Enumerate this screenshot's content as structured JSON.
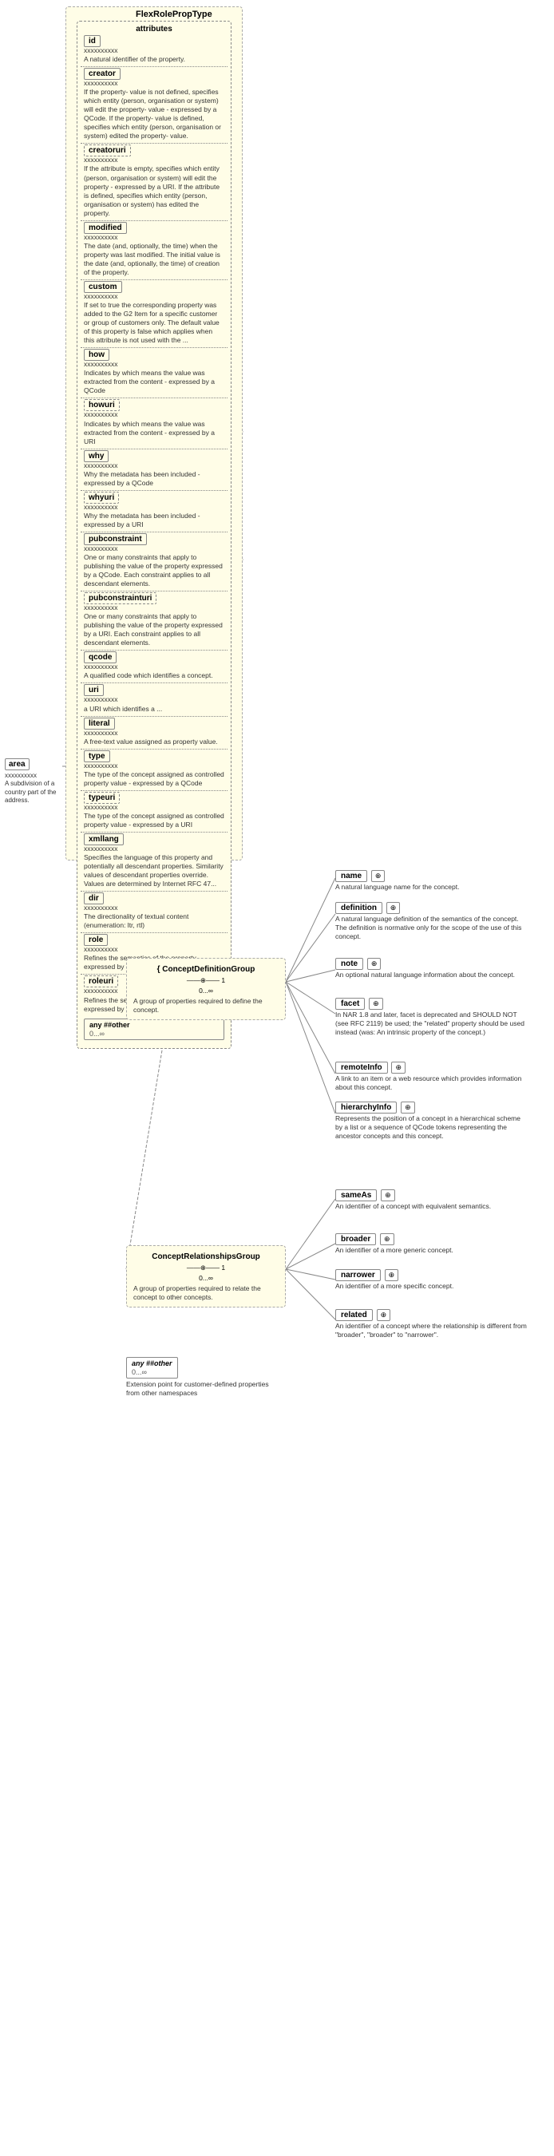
{
  "diagram": {
    "title": "FlexRolePropType",
    "attributes_label": "attributes",
    "attributes": [
      {
        "name": "id",
        "uri": false,
        "dotted_name": "xxxxxxxxxx",
        "desc": "A natural identifier of the property."
      },
      {
        "name": "creator",
        "uri": false,
        "dotted_name": "xxxxxxxxxx",
        "desc": "If the property- value is not defined, specifies which entity (person, organisation or system) will edit the property- value - expressed by a QCode. If the property- value is defined, specifies which entity (person, organisation or system) edited the property- value."
      },
      {
        "name": "creatoruri",
        "uri": true,
        "dotted_name": "xxxxxxxxxx",
        "desc": "If the attribute is empty, specifies which entity (person, organisation or system) will edit the property - expressed by a URI. If the attribute is defined, specifies which entity (person, organisation or system) has edited the property."
      },
      {
        "name": "modified",
        "uri": false,
        "dotted_name": "xxxxxxxxxx",
        "desc": "The date (and, optionally, the time) when the property was last modified. The initial value is the date (and, optionally, the time) of creation of the property."
      },
      {
        "name": "custom",
        "uri": false,
        "dotted_name": "xxxxxxxxxx",
        "desc": "If set to true the corresponding property was added to the G2 Item for a specific customer or group of customers only. The default value of this property is false which applies when this attribute is not used with the ..."
      },
      {
        "name": "how",
        "uri": false,
        "dotted_name": "xxxxxxxxxx",
        "desc": "Indicates by which means the value was extracted from the content - expressed by a QCode"
      },
      {
        "name": "howuri",
        "uri": true,
        "dotted_name": "xxxxxxxxxx",
        "desc": "Indicates by which means the value was extracted from the content - expressed by a URI"
      },
      {
        "name": "why",
        "uri": false,
        "dotted_name": "xxxxxxxxxx",
        "desc": "Why the metadata has been included - expressed by a QCode"
      },
      {
        "name": "whyuri",
        "uri": true,
        "dotted_name": "xxxxxxxxxx",
        "desc": "Why the metadata has been included - expressed by a URI"
      },
      {
        "name": "pubconstraint",
        "uri": false,
        "dotted_name": "xxxxxxxxxx",
        "desc": "One or many constraints that apply to publishing the value of the property expressed by a QCode. Each constraint applies to all descendant elements."
      },
      {
        "name": "pubconstrainturi",
        "uri": true,
        "dotted_name": "xxxxxxxxxx",
        "desc": "One or many constraints that apply to publishing the value of the property expressed by a URI. Each constraint applies to all descendant elements."
      },
      {
        "name": "qcode",
        "uri": false,
        "dotted_name": "xxxxxxxxxx",
        "desc": "A qualified code which identifies a concept."
      },
      {
        "name": "uri",
        "uri": false,
        "dotted_name": "xxxxxxxxxx",
        "desc": "a URI which identifies a ..."
      },
      {
        "name": "literal",
        "uri": false,
        "dotted_name": "xxxxxxxxxx",
        "desc": "A free-text value assigned as property value."
      },
      {
        "name": "type",
        "uri": false,
        "dotted_name": "xxxxxxxxxx",
        "desc": "The type of the concept assigned as controlled property value - expressed by a QCode"
      },
      {
        "name": "typeuri",
        "uri": true,
        "dotted_name": "xxxxxxxxxx",
        "desc": "The type of the concept assigned as controlled property value - expressed by a URI"
      },
      {
        "name": "xmllang",
        "uri": false,
        "dotted_name": "xxxxxxxxxx",
        "desc": "Specifies the language of this property and potentially all descendant properties. Similarity values of descendant properties override. Values are determined by Internet RFC 47..."
      },
      {
        "name": "dir",
        "uri": false,
        "dotted_name": "xxxxxxxxxx",
        "desc": "The directionality of textual content (enumeration: ltr, rtl)"
      },
      {
        "name": "role",
        "uri": false,
        "dotted_name": "xxxxxxxxxx",
        "desc": "Refines the semantics of the property - expressed by a QCode"
      },
      {
        "name": "roleuri",
        "uri": true,
        "dotted_name": "xxxxxxxxxx",
        "desc": "Refines the semantics of the property - expressed by a URI"
      }
    ],
    "any_other_main": {
      "label": "any ##other",
      "mult": "0...∞"
    },
    "area": {
      "name": "area",
      "dotted_name": "xxxxxxxxxx",
      "desc": "A subdivision of a country part of the address."
    },
    "right_items_top": [
      {
        "name": "name",
        "uri": false,
        "mult": "",
        "desc": "A natural language name for the concept."
      },
      {
        "name": "definition",
        "uri": false,
        "mult": "",
        "desc": "A natural language definition of the semantics of the concept. The definition is normative only for the scope of the use of this concept."
      },
      {
        "name": "note",
        "uri": false,
        "mult": "",
        "desc": "An optional natural language information about the concept."
      },
      {
        "name": "facet",
        "uri": false,
        "mult": "",
        "desc": "In NAR 1.8 and later, facet is deprecated and SHOULD NOT (see RFC 2119) be used; the \"related\" property should be used instead (was: An intrinsic property of the concept.)"
      },
      {
        "name": "remoteInfo",
        "uri": false,
        "mult": "",
        "desc": "A link to an item or a web resource which provides information about this concept."
      },
      {
        "name": "hierarchyInfo",
        "uri": false,
        "mult": "",
        "desc": "Represents the position of a concept in a hierarchical scheme by a list or a sequence of QCode tokens representing the ancestor concepts and this concept."
      },
      {
        "name": "sameAs",
        "uri": false,
        "mult": "",
        "desc": "An identifier of a concept with equivalent semantics."
      },
      {
        "name": "broader",
        "uri": false,
        "mult": "",
        "desc": "An identifier of a more generic concept."
      },
      {
        "name": "narrower",
        "uri": false,
        "mult": "",
        "desc": "An identifier of a more specific concept."
      },
      {
        "name": "related",
        "uri": false,
        "mult": "",
        "desc": "An identifier of a concept where the relationship is different from \"broader\", \"broader\" to \"narrower\"."
      }
    ],
    "concept_def_group": {
      "title": "{ ConceptDefinitionGroup",
      "mult_left": "——",
      "mult_right": "1",
      "mult_bottom": "0...∞",
      "desc": "A group of properties required to define the concept."
    },
    "concept_rel_group": {
      "title": "ConceptRelationshipsGroup",
      "mult_left": "——",
      "mult_right": "1",
      "mult_bottom": "0...∞",
      "desc": "A group of properties required to relate the concept to other concepts."
    },
    "any_other_bottom": {
      "label": "any ##other",
      "mult": "0...∞",
      "desc": "Extension point for customer-defined properties from other namespaces"
    }
  }
}
